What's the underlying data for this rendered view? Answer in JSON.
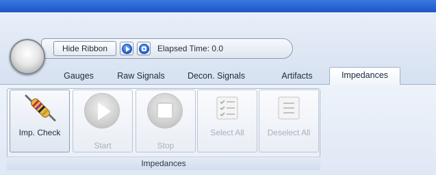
{
  "quick_access": {
    "hide_ribbon_label": "Hide Ribbon",
    "elapsed_label": "Elapsed Time:",
    "elapsed_value": "0.0"
  },
  "tabs": [
    {
      "label": "Gauges",
      "active": false
    },
    {
      "label": "Raw Signals",
      "active": false
    },
    {
      "label": "Decon. Signals",
      "active": false
    },
    {
      "label": "Artifacts",
      "active": false
    },
    {
      "label": "Impedances",
      "active": true
    }
  ],
  "ribbon": {
    "group_label": "Impedances",
    "buttons": {
      "imp_check": {
        "label": "Imp. Check",
        "enabled": true,
        "icon": "resistor-icon"
      },
      "start": {
        "label": "Start",
        "enabled": false,
        "icon": "play-icon"
      },
      "stop": {
        "label": "Stop",
        "enabled": false,
        "icon": "stop-icon"
      },
      "select_all": {
        "label": "Select All",
        "enabled": false,
        "icon": "checklist-icon"
      },
      "deselect_all": {
        "label": "Deselect All",
        "enabled": false,
        "icon": "list-icon"
      }
    }
  },
  "colors": {
    "titlebar": "#1d56c9",
    "accent_blue": "#1f5fd6",
    "disabled_text": "#a9b0ba",
    "resistor_body": "#e8b64a"
  }
}
